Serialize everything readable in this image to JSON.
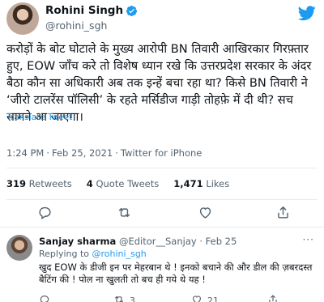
{
  "tweet": {
    "author_name": "Rohini Singh",
    "author_handle": "@rohini_sgh",
    "text": "करोड़ों के बोट घोटाले के मुख्य आरोपी BN तिवारी आखिरकार गिरफ़्तार हुए, EOW जाँच करे तो विशेष ध्यान रखे कि उत्तरप्रदेश सरकार के अंदर बैठा कौन सा अधिकारी अब तक इन्हें बचा रहा था? किसे BN तिवारी ने ‘जीरो टालरेंस पॉलिसी’ के रहते मर्सिडीज गाड़ी तोहफ़े में दी थी? सच सामने आ जाएगा।",
    "translate_label": "Translate Tweet",
    "time": "1:24 PM",
    "date": "Feb 25, 2021",
    "source": "Twitter for iPhone",
    "separator": "·"
  },
  "stats": {
    "retweets_count": "319",
    "retweets_label": "Retweets",
    "quotes_count": "4",
    "quotes_label": "Quote Tweets",
    "likes_count": "1,471",
    "likes_label": "Likes"
  },
  "icons": {
    "verified": "verified-badge-icon",
    "twitter": "twitter-bird-icon",
    "reply": "reply-icon",
    "retweet": "retweet-icon",
    "like": "heart-icon",
    "share": "share-icon",
    "more": "more-dots-icon"
  },
  "colors": {
    "accent": "#1d9bf0",
    "text": "#0f1419",
    "muted": "#536471",
    "divider": "#e6ecf0"
  },
  "reply": {
    "author_name": "Sanjay sharma",
    "author_handle": "@Editor__Sanjay",
    "separator": "·",
    "date": "Feb 25",
    "more": "···",
    "replying_prefix": "Replying to",
    "replying_mention": "@rohini_sgh",
    "text": "खुद EOW के डीजी इन पर मेहरबान थे ! इनको बचाने की और डील की ज़बरदस्त बैटिंग की ! पोल ना खुलती तो बच ही गये थे यह !",
    "retweet_count": "3",
    "like_count": "21"
  }
}
